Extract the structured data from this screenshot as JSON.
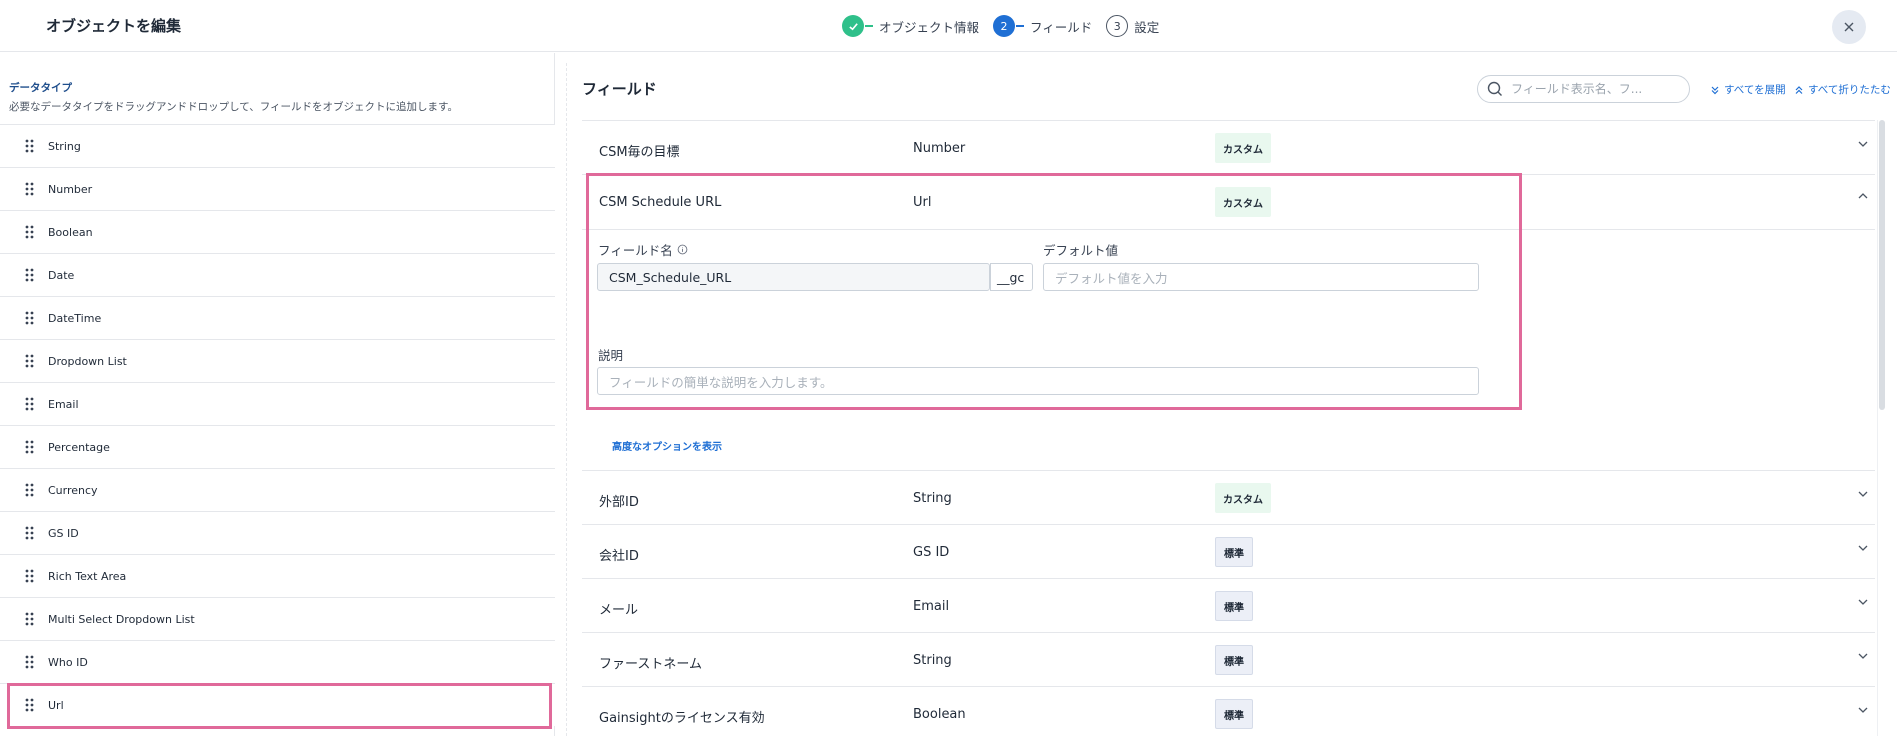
{
  "header": {
    "title": "オブジェクトを編集",
    "steps": [
      {
        "number": "1",
        "label": "オブジェクト情報",
        "state": "done"
      },
      {
        "number": "2",
        "label": "フィールド",
        "state": "active"
      },
      {
        "number": "3",
        "label": "設定",
        "state": "todo"
      }
    ],
    "close_icon": "close-icon"
  },
  "left_panel": {
    "title": "データタイプ",
    "description": "必要なデータタイプをドラッグアンドドロップして、フィールドをオブジェクトに追加します。",
    "data_types": [
      "String",
      "Number",
      "Boolean",
      "Date",
      "DateTime",
      "Dropdown List",
      "Email",
      "Percentage",
      "Currency",
      "GS ID",
      "Rich Text Area",
      "Multi Select Dropdown List",
      "Who ID",
      "Url"
    ],
    "highlighted_item": "Url"
  },
  "fields_panel": {
    "title": "フィールド",
    "search_placeholder": "フィールド表示名、フ...",
    "expand_all": "すべてを展開",
    "collapse_all": "すべて折りたたむ",
    "rows": [
      {
        "name": "CSM毎の目標",
        "type": "Number",
        "badge": "カスタム",
        "badge_kind": "custom",
        "expanded": false
      },
      {
        "name": "CSM Schedule URL",
        "type": "Url",
        "badge": "カスタム",
        "badge_kind": "custom",
        "expanded": true
      },
      {
        "name": "外部ID",
        "type": "String",
        "badge": "カスタム",
        "badge_kind": "custom",
        "expanded": false
      },
      {
        "name": "会社ID",
        "type": "GS ID",
        "badge": "標準",
        "badge_kind": "standard",
        "expanded": false
      },
      {
        "name": "メール",
        "type": "Email",
        "badge": "標準",
        "badge_kind": "standard",
        "expanded": false
      },
      {
        "name": "ファーストネーム",
        "type": "String",
        "badge": "標準",
        "badge_kind": "standard",
        "expanded": false
      },
      {
        "name": "Gainsightのライセンス有効",
        "type": "Boolean",
        "badge": "標準",
        "badge_kind": "standard",
        "expanded": false
      }
    ],
    "expanded_detail": {
      "field_name_label": "フィールド名",
      "field_name_value": "CSM_Schedule_URL",
      "field_name_suffix": "__gc",
      "default_value_label": "デフォルト値",
      "default_value_placeholder": "デフォルト値を入力",
      "description_label": "説明",
      "description_placeholder": "フィールドの簡単な説明を入力します。",
      "advanced_options_link": "高度なオプションを表示"
    }
  },
  "colors": {
    "accent": "#1f6fd4",
    "done": "#2fc08a",
    "highlight": "#e0699a",
    "custom_badge_bg": "#e9f8ef",
    "standard_badge_bg": "#eceff7"
  }
}
